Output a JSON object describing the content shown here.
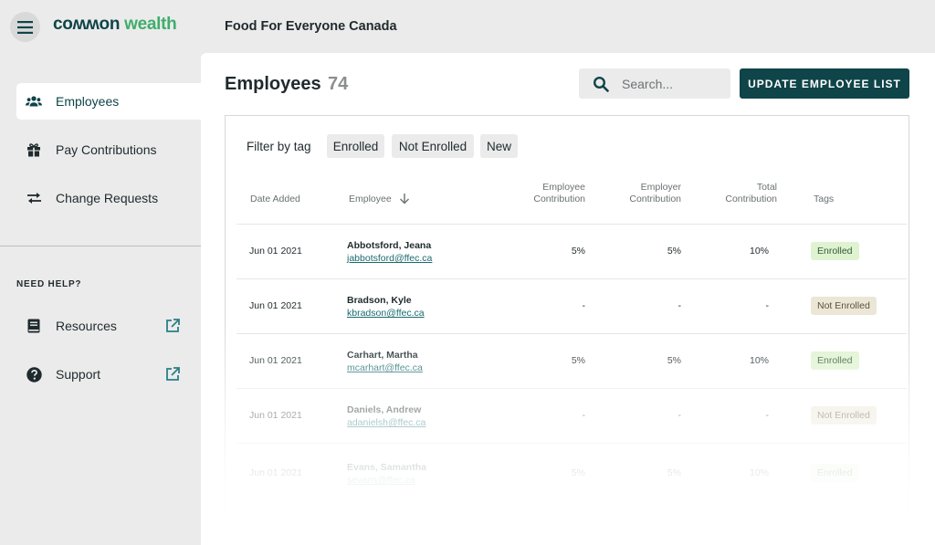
{
  "header": {
    "logo_part1": "coʍʍon",
    "logo_part2": "wealth",
    "org_name": "Food For Everyone Canada"
  },
  "sidebar": {
    "items": [
      {
        "label": "Employees",
        "icon": "users-icon",
        "active": true
      },
      {
        "label": "Pay Contributions",
        "icon": "gift-icon",
        "active": false
      },
      {
        "label": "Change Requests",
        "icon": "swap-arrows-icon",
        "active": false
      }
    ],
    "help_title": "NEED HELP?",
    "help_items": [
      {
        "label": "Resources",
        "icon": "book-icon"
      },
      {
        "label": "Support",
        "icon": "question-circle-icon"
      }
    ]
  },
  "main": {
    "title": "Employees",
    "count": "74",
    "search_placeholder": "Search...",
    "update_button": "UPDATE EMPLOYEE LIST",
    "filter_label": "Filter by tag",
    "filter_chips": [
      "Enrolled",
      "Not Enrolled",
      "New"
    ],
    "columns": {
      "date_added": "Date Added",
      "employee": "Employee",
      "employee_contribution": [
        "Employee",
        "Contribution"
      ],
      "employer_contribution": [
        "Employer",
        "Contribution"
      ],
      "total_contribution": [
        "Total",
        "Contribution"
      ],
      "tags": "Tags"
    },
    "rows": [
      {
        "date": "Jun 01 2021",
        "name": "Abbotsford, Jeana",
        "email": "jabbotsford@ffec.ca",
        "employee_contribution": "5%",
        "employer_contribution": "5%",
        "total": "10%",
        "tag": "Enrolled"
      },
      {
        "date": "Jun 01 2021",
        "name": "Bradson, Kyle",
        "email": "kbradson@ffec.ca",
        "employee_contribution": "-",
        "employer_contribution": "-",
        "total": "-",
        "tag": "Not Enrolled"
      },
      {
        "date": "Jun 01 2021",
        "name": "Carhart, Martha",
        "email": "mcarhart@ffec.ca",
        "employee_contribution": "5%",
        "employer_contribution": "5%",
        "total": "10%",
        "tag": "Enrolled"
      },
      {
        "date": "Jun 01 2021",
        "name": "Daniels, Andrew",
        "email": "adanielsh@ffec.ca",
        "employee_contribution": "-",
        "employer_contribution": "-",
        "total": "-",
        "tag": "Not Enrolled"
      },
      {
        "date": "Jun 01 2021",
        "name": "Evans, Samantha",
        "email": "sevans@ffec.ca",
        "employee_contribution": "5%",
        "employer_contribution": "5%",
        "total": "10%",
        "tag": "Enrolled"
      }
    ]
  },
  "colors": {
    "brand_dark": "#0f4449",
    "brand_green": "#3fae6c",
    "enrolled_bg": "#dff3d0",
    "not_enrolled_bg": "#ece6d6"
  }
}
